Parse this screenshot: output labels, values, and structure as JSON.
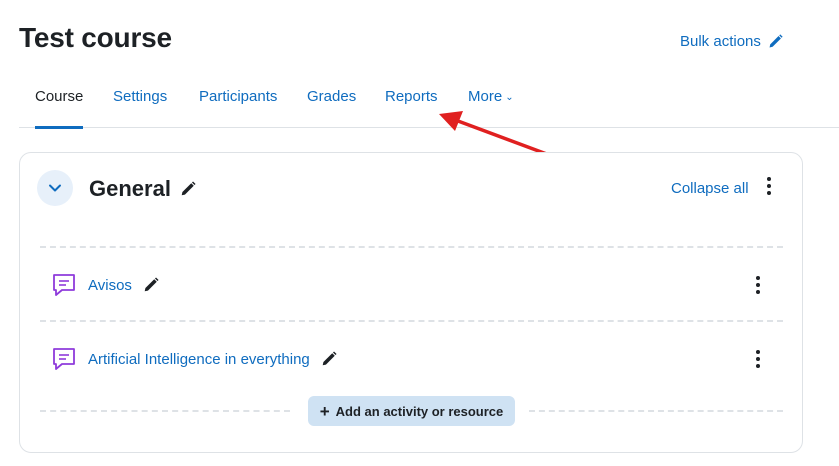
{
  "course": {
    "title": "Test course"
  },
  "header": {
    "bulk_actions": "Bulk actions"
  },
  "tabs": [
    {
      "label": "Course",
      "active": true
    },
    {
      "label": "Settings"
    },
    {
      "label": "Participants"
    },
    {
      "label": "Grades"
    },
    {
      "label": "Reports"
    },
    {
      "label": "More"
    }
  ],
  "section": {
    "title": "General",
    "collapse_all": "Collapse all",
    "activities": [
      {
        "name": "Avisos",
        "icon": "forum-icon"
      },
      {
        "name": "Artificial Intelligence in everything",
        "icon": "forum-icon"
      }
    ],
    "add_label": "Add an activity or resource"
  },
  "colors": {
    "link": "#0f6cbf",
    "text": "#1d2125",
    "activity_icon": "#8f3bdb",
    "annotation_arrow": "#e02020"
  }
}
